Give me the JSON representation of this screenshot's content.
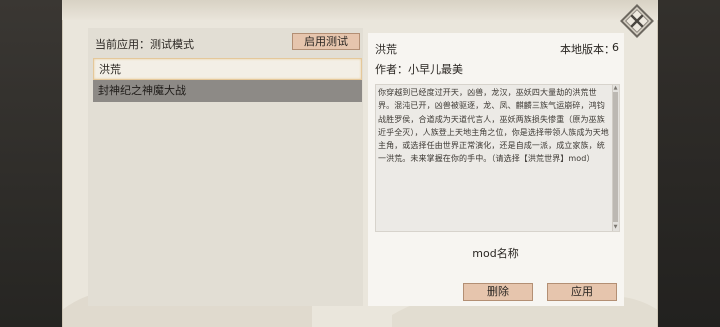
{
  "left_panel": {
    "current_app_label": "当前应用：测试模式",
    "enable_test_button": "启用测试",
    "mods": [
      {
        "name": "洪荒",
        "selected": true
      },
      {
        "name": "封神纪之神魔大战",
        "selected": false
      }
    ]
  },
  "detail": {
    "title": "洪荒",
    "local_version_label": "本地版本：",
    "local_version_value": "6",
    "author": "作者：小早儿最美",
    "description": "你穿越到已经度过开天，凶兽，龙汉，巫妖四大量劫的洪荒世界。混沌已开，凶兽被驱逐，龙、凤、麒麟三族气运崩碎，鸿钧战胜罗侯，合道成为天道代言人，巫妖两族损失惨重（原为巫族近乎全灭），人族登上天地主角之位，你是选择带领人族成为天地主角，或选择任由世界正常演化，还是自成一派，成立家族，统一洪荒。未来掌握在你的手中。（请选择【洪荒世界】mod）",
    "mod_name_label": "mod名称",
    "delete_button": "删除",
    "apply_button": "应用"
  },
  "icons": {
    "close": "close-icon",
    "scroll_up": "scroll-up-arrow-icon",
    "scroll_down": "scroll-down-arrow-icon"
  }
}
